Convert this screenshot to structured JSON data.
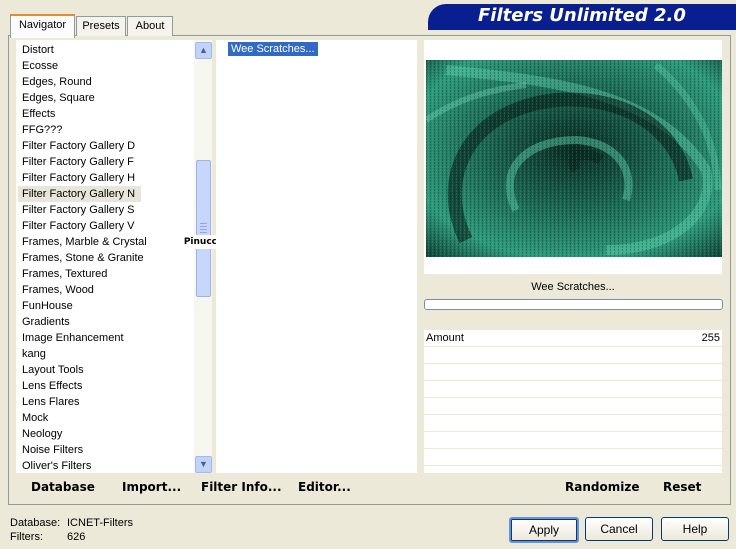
{
  "tabs": [
    {
      "label": "Navigator",
      "active": true
    },
    {
      "label": "Presets",
      "active": false
    },
    {
      "label": "About",
      "active": false
    }
  ],
  "banner": {
    "title": "Filters Unlimited 2.0"
  },
  "categories": [
    "Distort",
    "Ecosse",
    "Edges, Round",
    "Edges, Square",
    "Effects",
    "FFG???",
    "Filter Factory Gallery D",
    "Filter Factory Gallery F",
    "Filter Factory Gallery H",
    "Filter Factory Gallery N",
    "Filter Factory Gallery S",
    "Filter Factory Gallery V",
    "Frames, Marble & Crystal",
    "Frames, Stone & Granite",
    "Frames, Textured",
    "Frames, Wood",
    "FunHouse",
    "Gradients",
    "Image Enhancement",
    "kang",
    "Layout Tools",
    "Lens Effects",
    "Lens Flares",
    "Mock",
    "Neology",
    "Noise Filters",
    "Oliver's Filters"
  ],
  "selected_category": "Filter Factory Gallery N",
  "filters": {
    "selected": "Wee Scratches..."
  },
  "watermark": "Pinuccia",
  "preview": {
    "filter_name": "Wee Scratches...",
    "accent_color": "#2a9a7a"
  },
  "params": [
    {
      "name": "Amount",
      "value": "255"
    }
  ],
  "toolbar": {
    "database": "Database",
    "import": "Import...",
    "filter_info": "Filter Info...",
    "editor": "Editor...",
    "randomize": "Randomize",
    "reset": "Reset"
  },
  "status": {
    "database_label": "Database:",
    "database_value": "ICNET-Filters",
    "filters_label": "Filters:",
    "filters_value": "626"
  },
  "buttons": {
    "apply": "Apply",
    "cancel": "Cancel",
    "help": "Help"
  }
}
